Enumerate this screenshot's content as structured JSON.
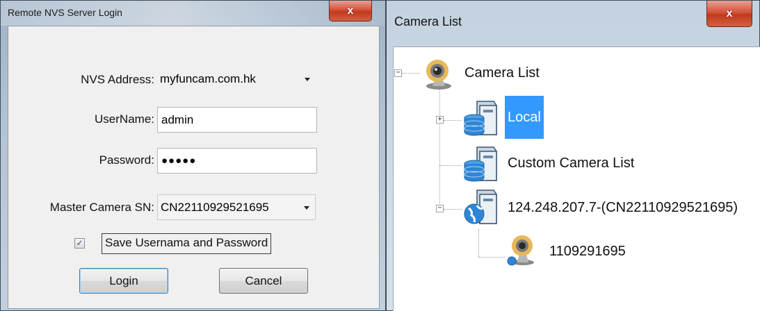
{
  "login": {
    "title": "Remote NVS Server Login",
    "close_label": "x",
    "nvs_address_label": "NVS Address:",
    "nvs_address_value": "myfuncam.com.hk",
    "username_label": "UserName:",
    "username_value": "admin",
    "password_label": "Password:",
    "password_value": "●●●●●",
    "master_sn_label": "Master Camera SN:",
    "master_sn_value": "CN22110929521695",
    "save_checked_glyph": "✓",
    "save_label": "Save Usernama and Password",
    "login_button": "Login",
    "cancel_button": "Cancel"
  },
  "camera_list": {
    "title": "Camera List",
    "close_label": "x",
    "tree": [
      {
        "label": "Camera List",
        "icon": "webcam-icon",
        "expander": "−"
      },
      {
        "label": "Local",
        "icon": "database-server-icon",
        "expander": "+",
        "selected": true
      },
      {
        "label": "Custom Camera List",
        "icon": "database-server-icon"
      },
      {
        "label": "124.248.207.7-(CN22110929521695)",
        "icon": "network-server-icon",
        "expander": "−"
      },
      {
        "label": "1109291695",
        "icon": "webcam-icon"
      }
    ]
  },
  "colors": {
    "selection": "#3399ff",
    "close_button": "#c23a1f"
  }
}
